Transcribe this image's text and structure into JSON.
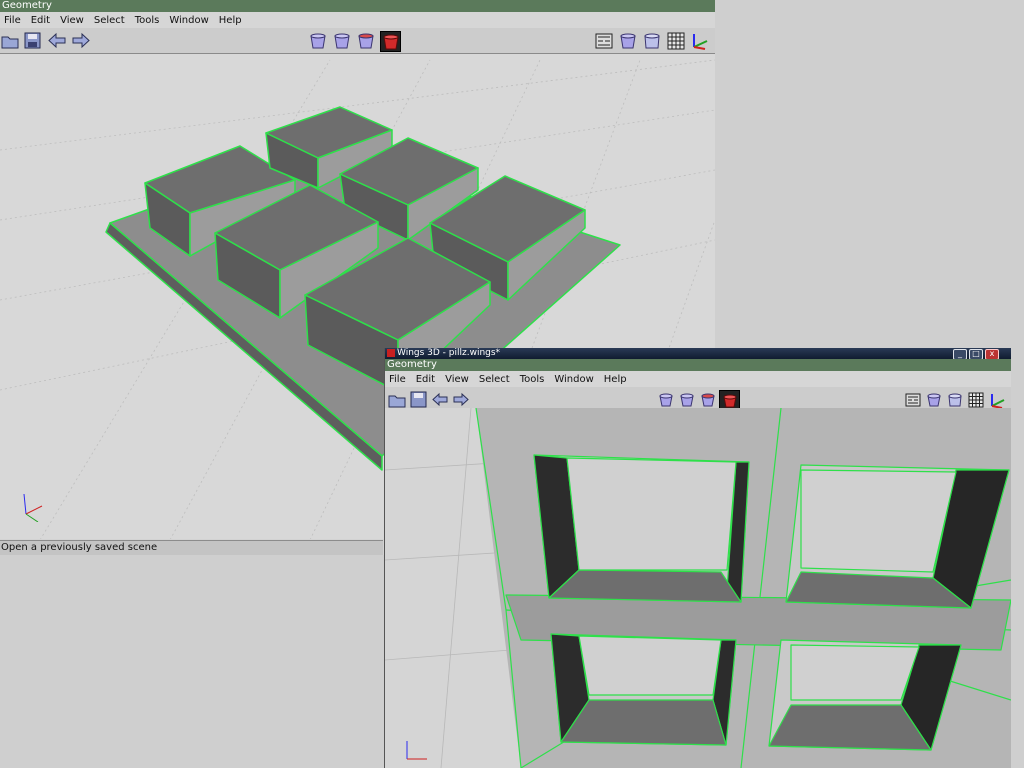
{
  "main_window": {
    "title": "Geometry",
    "menu": [
      "File",
      "Edit",
      "View",
      "Select",
      "Tools",
      "Window",
      "Help"
    ],
    "status": "Open a previously saved scene"
  },
  "second_window": {
    "os_title": "Wings 3D - pillz.wings*",
    "title": "Geometry",
    "menu": [
      "File",
      "Edit",
      "View",
      "Select",
      "Tools",
      "Window",
      "Help"
    ]
  },
  "icons": {
    "left": [
      "open-folder-icon",
      "save-icon",
      "undo-arrow-icon",
      "redo-arrow-icon"
    ],
    "select_modes": [
      "vertex-mode-icon",
      "edge-mode-icon",
      "face-mode-icon",
      "body-mode-icon"
    ],
    "right": [
      "layout-icon",
      "perspective-icon",
      "smooth-preview-icon",
      "grid-icon",
      "axes-icon"
    ]
  },
  "colors": {
    "accent_green": "#2ee04a",
    "face_dark": "#7a7a7a",
    "face_light": "#aaaaaa",
    "selected_red": "#d12a2a"
  }
}
